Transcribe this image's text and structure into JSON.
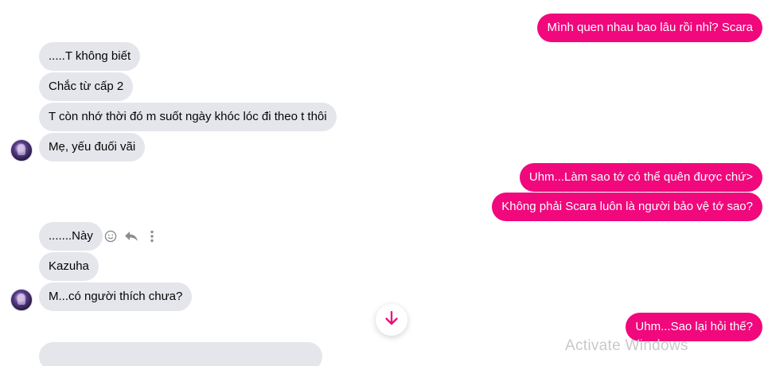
{
  "thread": {
    "outgoing": [
      {
        "text": "Mình quen nhau bao lâu rồi nhỉ? Scara"
      },
      {
        "text": "Uhm...Làm sao tớ có thể quên được chứ>"
      },
      {
        "text": "Không phải Scara luôn là người bảo vệ tớ sao?"
      },
      {
        "text": "Uhm...Sao lại hỏi thế?"
      }
    ],
    "incoming_group_1": [
      {
        "text": ".....T không biết"
      },
      {
        "text": "Chắc từ cấp 2"
      },
      {
        "text": "T còn nhớ thời đó m suốt ngày khóc lóc đi theo t thôi"
      },
      {
        "text": "Mẹ, yếu đuối vãi"
      }
    ],
    "incoming_group_2": [
      {
        "text": ".......Này"
      },
      {
        "text": "Kazuha"
      },
      {
        "text": "M...có người thích chưa?"
      }
    ]
  },
  "message_actions": {
    "icons": [
      "smiley-react-icon",
      "reply-icon",
      "more-options-icon"
    ]
  },
  "scroll_to_bottom": {
    "icon": "arrow-down-icon",
    "color": "#f0087c"
  },
  "colors": {
    "outgoing_bubble": "#f0087c",
    "incoming_bubble": "#e4e6eb"
  },
  "overlay": {
    "watermark": "Activate Windows"
  }
}
